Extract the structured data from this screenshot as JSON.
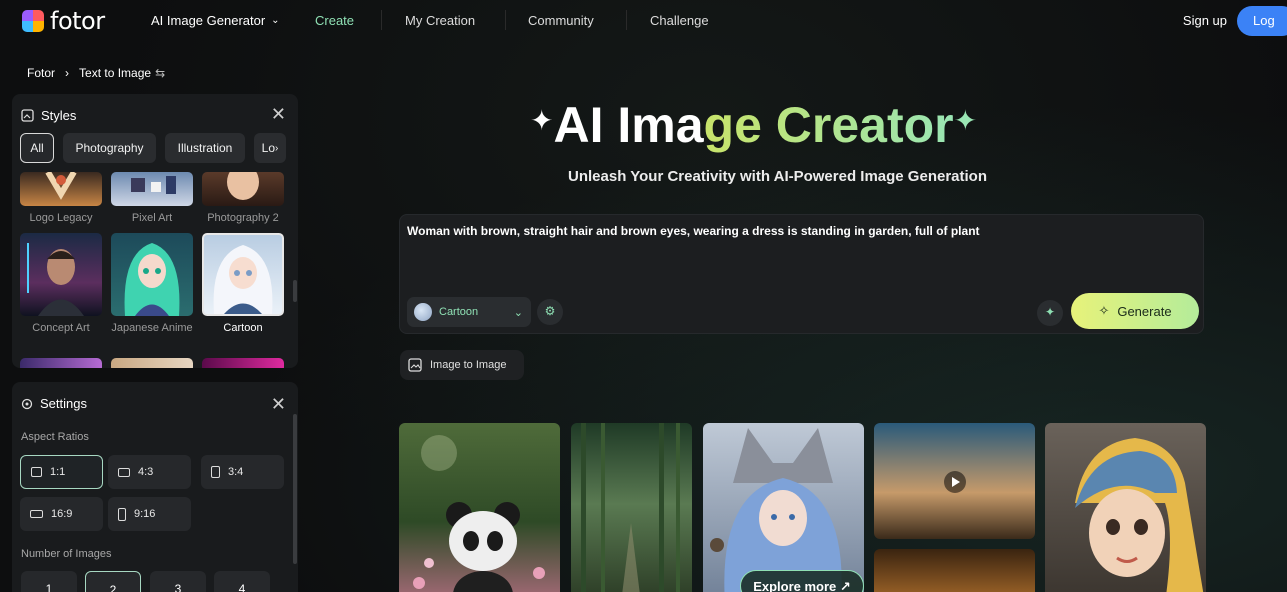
{
  "brand": {
    "logo_text": "fotor"
  },
  "nav": {
    "generator_menu": "AI Image Generator",
    "items": [
      "Create",
      "My Creation",
      "Community",
      "Challenge"
    ],
    "sign_up": "Sign up",
    "login": "Log"
  },
  "breadcrumb": {
    "root": "Fotor",
    "current": "Text to Image",
    "swap_icon": "⇆"
  },
  "styles_panel": {
    "title": "Styles",
    "chips": [
      "All",
      "Photography",
      "Illustration",
      "Lo"
    ],
    "active_chip": "All",
    "items": [
      {
        "label": "Logo Legacy"
      },
      {
        "label": "Pixel Art"
      },
      {
        "label": "Photography 2"
      },
      {
        "label": "Concept Art"
      },
      {
        "label": "Japanese Anime"
      },
      {
        "label": "Cartoon"
      }
    ],
    "selected_item": "Cartoon"
  },
  "settings_panel": {
    "title": "Settings",
    "aspect_label": "Aspect Ratios",
    "ratios": [
      "1:1",
      "4:3",
      "3:4",
      "16:9",
      "9:16"
    ],
    "active_ratio": "1:1",
    "images_label": "Number of Images",
    "counts": [
      "1",
      "2",
      "3",
      "4"
    ],
    "active_count": "2"
  },
  "hero": {
    "title_a": "AI Ima",
    "title_b": "ge Creator",
    "subtitle": "Unleash Your Creativity with AI-Powered Image Generation"
  },
  "prompt": {
    "text": "Woman with brown, straight hair and brown eyes, wearing a dress is standing in garden, full of plant",
    "style": "Cartoon",
    "generate_label": "Generate"
  },
  "image_to_image": "Image to Image",
  "gallery": {
    "explore_label": "Explore more ↗"
  },
  "colors": {
    "accent": "#8fe0b4",
    "generate_start": "#e7f27a",
    "login": "#3b82f6"
  }
}
